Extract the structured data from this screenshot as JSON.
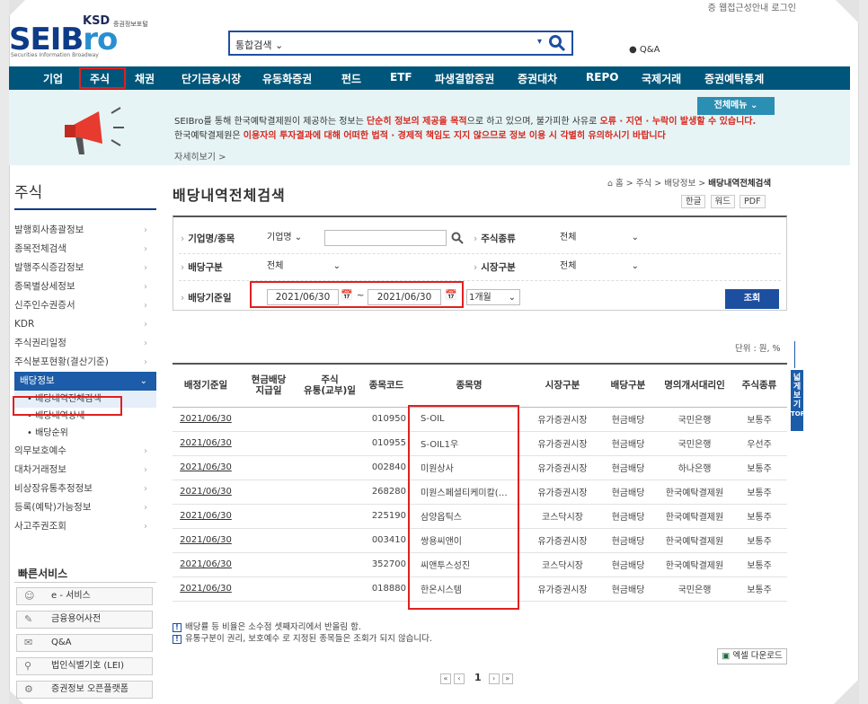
{
  "header": {
    "logo_ksd": "KSD",
    "logo_ksd_sub": "증권정보포털",
    "logo_brand_a": "SEIB",
    "logo_brand_b": "ro",
    "logo_tagline": "Securities Information Broadway",
    "search_category": "통합검색",
    "top_links": "증  웹접근성안내    로그인",
    "qa_label": "Q&A"
  },
  "nav": {
    "items": [
      "기업",
      "주식",
      "채권",
      "단기금융시장",
      "유동화증권",
      "펀드",
      "ETF",
      "파생결합증권",
      "증권대차",
      "REPO",
      "국제거래",
      "증권예탁통계"
    ]
  },
  "banner": {
    "line1_pre": "SEIBro를 통해 한국예탁결제원이 제공하는 정보는 ",
    "line1_red1": "단순히 정보의 제공을 목적",
    "line1_mid": "으로 하고 있으며, 불가피한 사유로 ",
    "line1_red2": "오류 · 지연 · 누락이 발생할 수 있습니다.",
    "line2_pre": "한국예탁결제원은 ",
    "line2_red": "이용자의 투자결과에 대해 어떠한 법적 · 경제적 책임도 지지 않으므로 정보 이용 시 각별히 유의하시기 바랍니다",
    "more": "자세히보기 >",
    "all_menu": "전체메뉴  ⌄"
  },
  "sidebar": {
    "title": "주식",
    "items": [
      {
        "label": "발행회사총괄정보"
      },
      {
        "label": "종목전체검색"
      },
      {
        "label": "발행주식증감정보"
      },
      {
        "label": "종목별상세정보"
      },
      {
        "label": "신주인수권증서"
      },
      {
        "label": "KDR"
      },
      {
        "label": "주식권리일정"
      },
      {
        "label": "주식분포현황(결산기준)"
      }
    ],
    "active": "배당정보",
    "subitems": [
      "• 배당내역전체검색",
      "• 배당내역상세",
      "• 배당순위"
    ],
    "items2": [
      {
        "label": "의무보호예수"
      },
      {
        "label": "대차거래정보"
      },
      {
        "label": "비상장유통추정정보"
      },
      {
        "label": "등록(예탁)가능정보"
      },
      {
        "label": "사고주권조회"
      }
    ],
    "quick_title": "빠른서비스",
    "quick": [
      "e - 서비스",
      "금융용어사전",
      "Q&A",
      "법인식별기호 (LEI)",
      "증권정보 오픈플랫폼"
    ],
    "quick_icons": [
      "☺",
      "✎",
      "✉",
      "⚲",
      "⚙"
    ]
  },
  "main": {
    "title": "배당내역전체검색",
    "breadcrumb_home": "⌂ 홈 > 주식 > 배당정보 > ",
    "breadcrumb_current": "배당내역전체검색",
    "docs": [
      "한글",
      "워드",
      "PDF"
    ],
    "filter": {
      "company_label": "기업명/종목",
      "company_select": "기업명",
      "stock_type_label": "주식종류",
      "stock_type_value": "전체",
      "div_type_label": "배당구분",
      "div_type_value": "전체",
      "market_label": "시장구분",
      "market_value": "전체",
      "date_label": "배당기준일",
      "date_from": "2021/06/30",
      "date_to": "2021/06/30",
      "period": "1개월",
      "search_button": "조회"
    },
    "unit": "단위 : 원, %",
    "columns": [
      "배정기준일",
      "현금배당\n지급일",
      "주식\n유통(교부)일",
      "종목코드",
      "종목명",
      "시장구분",
      "배당구분",
      "명의개서대리인",
      "주식종류"
    ],
    "rows": [
      [
        "2021/06/30",
        "",
        "",
        "010950",
        "S-OIL",
        "유가증권시장",
        "현금배당",
        "국민은행",
        "보통주"
      ],
      [
        "2021/06/30",
        "",
        "",
        "010955",
        "S-OIL1우",
        "유가증권시장",
        "현금배당",
        "국민은행",
        "우선주"
      ],
      [
        "2021/06/30",
        "",
        "",
        "002840",
        "미원상사",
        "유가증권시장",
        "현금배당",
        "하나은행",
        "보통주"
      ],
      [
        "2021/06/30",
        "",
        "",
        "268280",
        "미원스페셜티케미칼(…",
        "유가증권시장",
        "현금배당",
        "한국예탁결제원",
        "보통주"
      ],
      [
        "2021/06/30",
        "",
        "",
        "225190",
        "삼양옵틱스",
        "코스닥시장",
        "현금배당",
        "한국예탁결제원",
        "보통주"
      ],
      [
        "2021/06/30",
        "",
        "",
        "003410",
        "쌍용씨앤이",
        "유가증권시장",
        "현금배당",
        "한국예탁결제원",
        "보통주"
      ],
      [
        "2021/06/30",
        "",
        "",
        "352700",
        "씨앤투스성진",
        "코스닥시장",
        "현금배당",
        "한국예탁결제원",
        "보통주"
      ],
      [
        "2021/06/30",
        "",
        "",
        "018880",
        "한온시스템",
        "유가증권시장",
        "현금배당",
        "국민은행",
        "보통주"
      ]
    ],
    "notes": [
      "배당률 등 비율은 소수점 셋째자리에서 반올림 함.",
      "유통구분이 권리, 보호예수 로 지정된 종목들은 조회가 되지 않습니다."
    ],
    "excel": "엑셀 다운로드",
    "page": "1",
    "side_tab": "넓게보기",
    "side_tab_top": "TOP"
  },
  "colors": {
    "nav": "#00567a",
    "brand": "#0d3b87",
    "accent": "#1d4fa0",
    "highlight": "#e12020"
  }
}
